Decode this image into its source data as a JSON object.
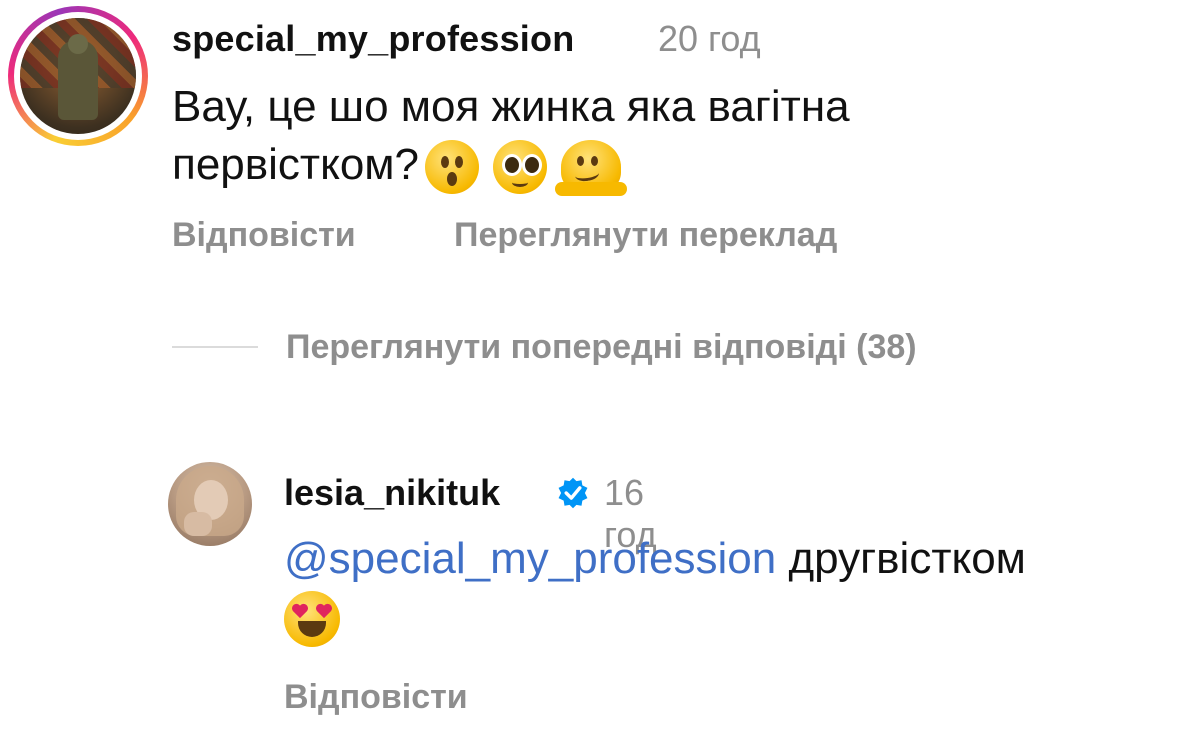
{
  "comment1": {
    "username": "special_my_profession",
    "time": "20 год",
    "text": "Вау, це шо моя жинка яка вагітна первістком?",
    "emojis": [
      "hushed-face-emoji",
      "pleading-face-emoji",
      "melting-face-emoji"
    ],
    "reply_label": "Відповісти",
    "translate_label": "Переглянути переклад",
    "avatar_ring": [
      "#f9ce34",
      "#ee2a7b",
      "#9b36b7"
    ]
  },
  "view_previous": {
    "label": "Переглянути попередні відповіді (38)"
  },
  "comment2": {
    "username": "lesia_nikituk",
    "verified": true,
    "verified_color": "#0095f6",
    "time": "16 год",
    "mention": "@special_my_profession",
    "text": "другвістком",
    "emojis": [
      "heart-eyes-emoji"
    ],
    "reply_label": "Відповісти"
  },
  "colors": {
    "secondary_text": "#8e8e8e",
    "mention": "#3f6fc6"
  }
}
